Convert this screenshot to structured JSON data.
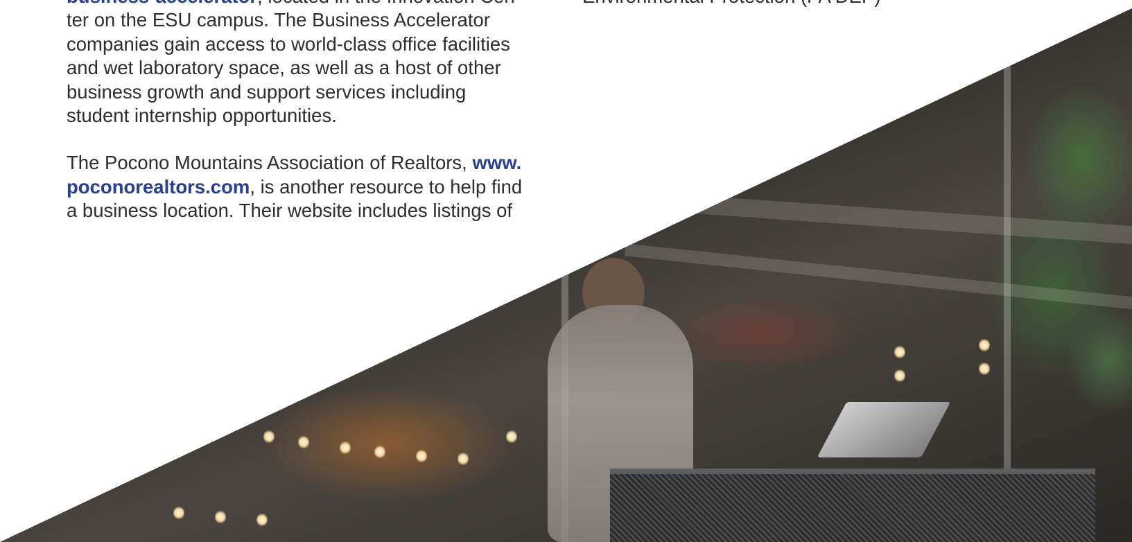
{
  "left_column": {
    "para1": {
      "link": "business-accelerator",
      "text_lines": [
        ", located in the Innovation Cen-",
        "ter on the ESU campus. The Business Accelerator",
        "companies gain access to world-class office facilities",
        "and wet laboratory space, as well as a host of other",
        "business growth and support services including",
        "student internship opportunities."
      ]
    },
    "para2": {
      "line1_text": "The Pocono Mountains Association of Realtors, ",
      "line1_link": "www.",
      "line2_link": "poconorealtors.com",
      "line2_text": ", is another resource to help find",
      "line3_text": "a business location. Their website includes listings of"
    }
  },
  "right_column": {
    "fragment": "Environmental Protection (PA DEP)"
  }
}
